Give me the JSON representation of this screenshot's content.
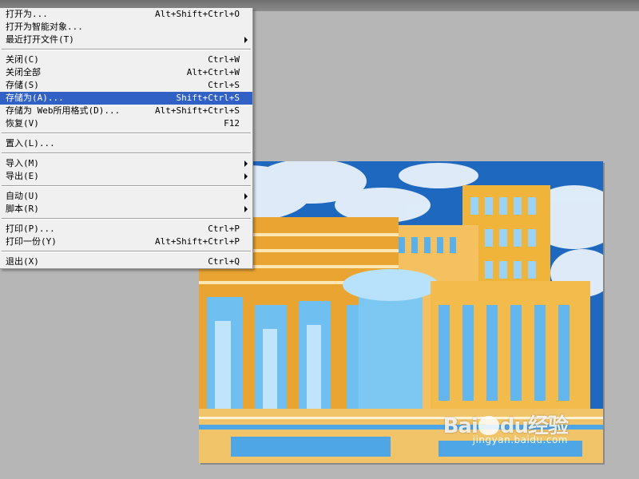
{
  "menu": {
    "items": [
      {
        "label": "打开为...",
        "shortcut": "Alt+Shift+Ctrl+O",
        "submenu": false
      },
      {
        "label": "打开为智能对象...",
        "shortcut": "",
        "submenu": false
      },
      {
        "label": "最近打开文件(T)",
        "shortcut": "",
        "submenu": true
      },
      {
        "separator": true
      },
      {
        "label": "关闭(C)",
        "shortcut": "Ctrl+W",
        "submenu": false
      },
      {
        "label": "关闭全部",
        "shortcut": "Alt+Ctrl+W",
        "submenu": false
      },
      {
        "label": "存储(S)",
        "shortcut": "Ctrl+S",
        "submenu": false
      },
      {
        "label": "存储为(A)...",
        "shortcut": "Shift+Ctrl+S",
        "submenu": false,
        "highlighted": true
      },
      {
        "label": "存储为 Web所用格式(D)...",
        "shortcut": "Alt+Shift+Ctrl+S",
        "submenu": false
      },
      {
        "label": "恢复(V)",
        "shortcut": "F12",
        "submenu": false
      },
      {
        "separator": true
      },
      {
        "label": "置入(L)...",
        "shortcut": "",
        "submenu": false
      },
      {
        "separator": true
      },
      {
        "label": "导入(M)",
        "shortcut": "",
        "submenu": true
      },
      {
        "label": "导出(E)",
        "shortcut": "",
        "submenu": true
      },
      {
        "separator": true
      },
      {
        "label": "自动(U)",
        "shortcut": "",
        "submenu": true
      },
      {
        "label": "脚本(R)",
        "shortcut": "",
        "submenu": true
      },
      {
        "separator": true
      },
      {
        "label": "打印(P)...",
        "shortcut": "Ctrl+P",
        "submenu": false
      },
      {
        "label": "打印一份(Y)",
        "shortcut": "Alt+Shift+Ctrl+P",
        "submenu": false
      },
      {
        "separator": true
      },
      {
        "label": "退出(X)",
        "shortcut": "Ctrl+Q",
        "submenu": false
      }
    ]
  },
  "watermark": {
    "logo_a": "Bai",
    "logo_b": "du",
    "logo_c": "经验",
    "url": "jingyan.baidu.com"
  },
  "colors": {
    "highlight": "#3161c5",
    "menu_bg": "#f0f0f0",
    "workspace": "#b6b6b6"
  }
}
